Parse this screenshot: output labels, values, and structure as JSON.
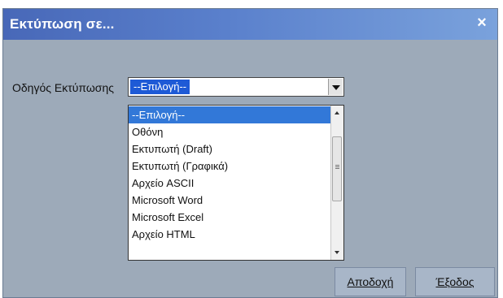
{
  "window": {
    "title": "Εκτύπωση σε...",
    "close_label": "×"
  },
  "form": {
    "driver_label": "Οδηγός Εκτύπωσης",
    "combo_value": "--Επιλογή--"
  },
  "dropdown": {
    "items": [
      "--Επιλογή--",
      "Οθόνη",
      "Εκτυπωτή (Draft)",
      "Εκτυπωτή (Γραφικά)",
      "Αρχείο ASCII",
      "Microsoft Word",
      "Microsoft Excel",
      "Αρχείο HTML"
    ],
    "selected_index": 0
  },
  "buttons": {
    "accept_label": "Αποδοχή",
    "exit_label": "Έξοδος"
  },
  "colors": {
    "selection": "#3278d8",
    "title_gradient_start": "#4868b8",
    "dialog_background": "#9daab9"
  }
}
